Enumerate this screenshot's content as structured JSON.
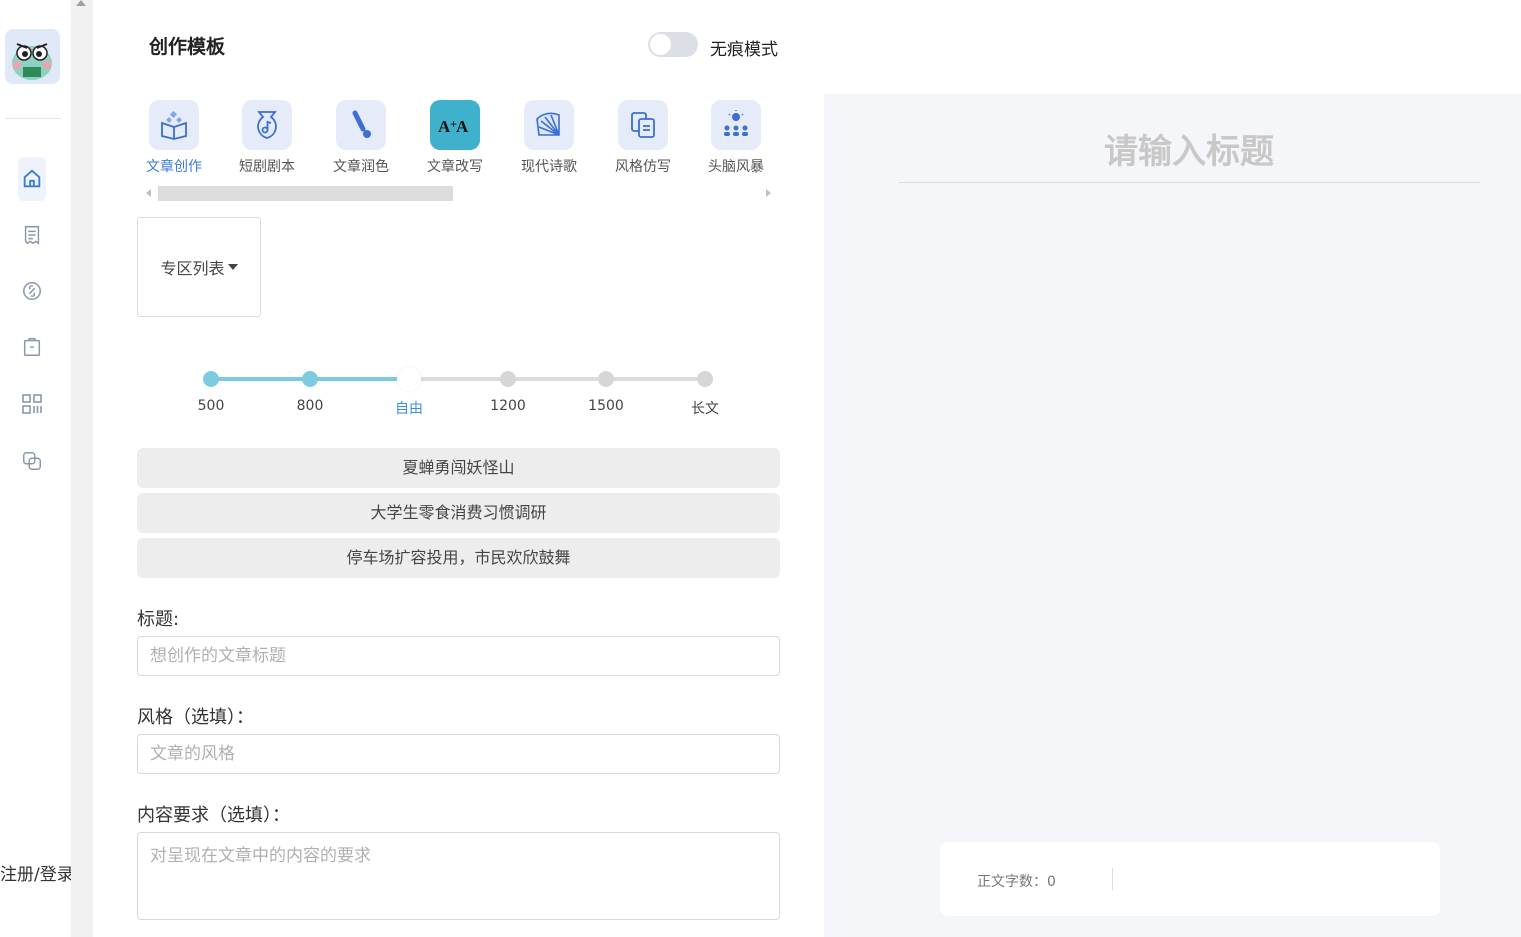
{
  "sidebar": {
    "login_label": "注册/登录",
    "icons": [
      "home-icon",
      "document-list-icon",
      "link-icon",
      "clipboard-icon",
      "grid-apps-icon",
      "copy-icon"
    ]
  },
  "header": {
    "title": "创作模板",
    "toggle_label": "无痕模式",
    "toggle_on": false
  },
  "templates": [
    {
      "label": "文章创作",
      "icon": "book-sparkle-icon",
      "active": true
    },
    {
      "label": "短剧剧本",
      "icon": "music-pen-icon",
      "active": false
    },
    {
      "label": "文章润色",
      "icon": "brush-icon",
      "active": false
    },
    {
      "label": "文章改写",
      "icon": "rewrite-a-icon",
      "active": false
    },
    {
      "label": "现代诗歌",
      "icon": "fan-icon",
      "active": false
    },
    {
      "label": "风格仿写",
      "icon": "copy-docs-icon",
      "active": false
    },
    {
      "label": "头脑风暴",
      "icon": "brainstorm-icon",
      "active": false
    }
  ],
  "zone": {
    "label": "专区列表"
  },
  "length_slider": {
    "options": [
      "500",
      "800",
      "自由",
      "1200",
      "1500",
      "长文"
    ],
    "selected_index": 2
  },
  "suggestions": [
    "夏蝉勇闯妖怪山",
    "大学生零食消费习惯调研",
    "停车场扩容投用，市民欢欣鼓舞"
  ],
  "form": {
    "title_label": "标题:",
    "title_placeholder": "想创作的文章标题",
    "style_label": "风格（选填）：",
    "style_placeholder": "文章的风格",
    "content_label": "内容要求（选填）：",
    "content_placeholder": "对呈现在文章中的内容的要求"
  },
  "editor": {
    "title_placeholder": "请输入标题",
    "word_count": "正文字数：0"
  },
  "colors": {
    "accent": "#3b7bd6",
    "slider": "#7ecbe1",
    "teal_icon": "#3fb1cc"
  }
}
